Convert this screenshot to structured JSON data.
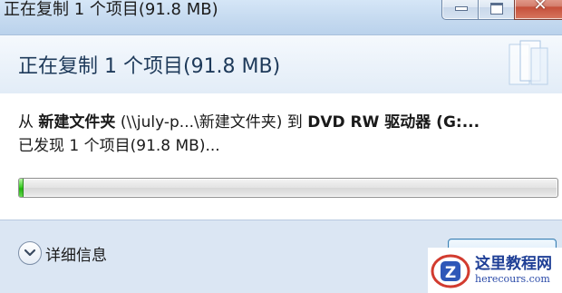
{
  "window": {
    "title": "正在复制 1 个项目(91.8 MB)"
  },
  "header": {
    "title": "正在复制 1 个项目(91.8 MB)"
  },
  "copy_info": {
    "from_prefix": "从",
    "source_name": "新建文件夹",
    "source_path": "(\\\\july-p...\\新建文件夹)",
    "to_word": "到",
    "destination": "DVD RW 驱动器 (G:...",
    "found_status": "已发现 1 个项目(91.8 MB)..."
  },
  "progress": {
    "fraction": 0.006,
    "color": "#3fd12a"
  },
  "footer": {
    "details_label": "详细信息",
    "details_icon": "chevron-down-icon",
    "cancel_label": "取消"
  },
  "watermark": {
    "title": "这里教程网",
    "url": "herecours.com"
  }
}
